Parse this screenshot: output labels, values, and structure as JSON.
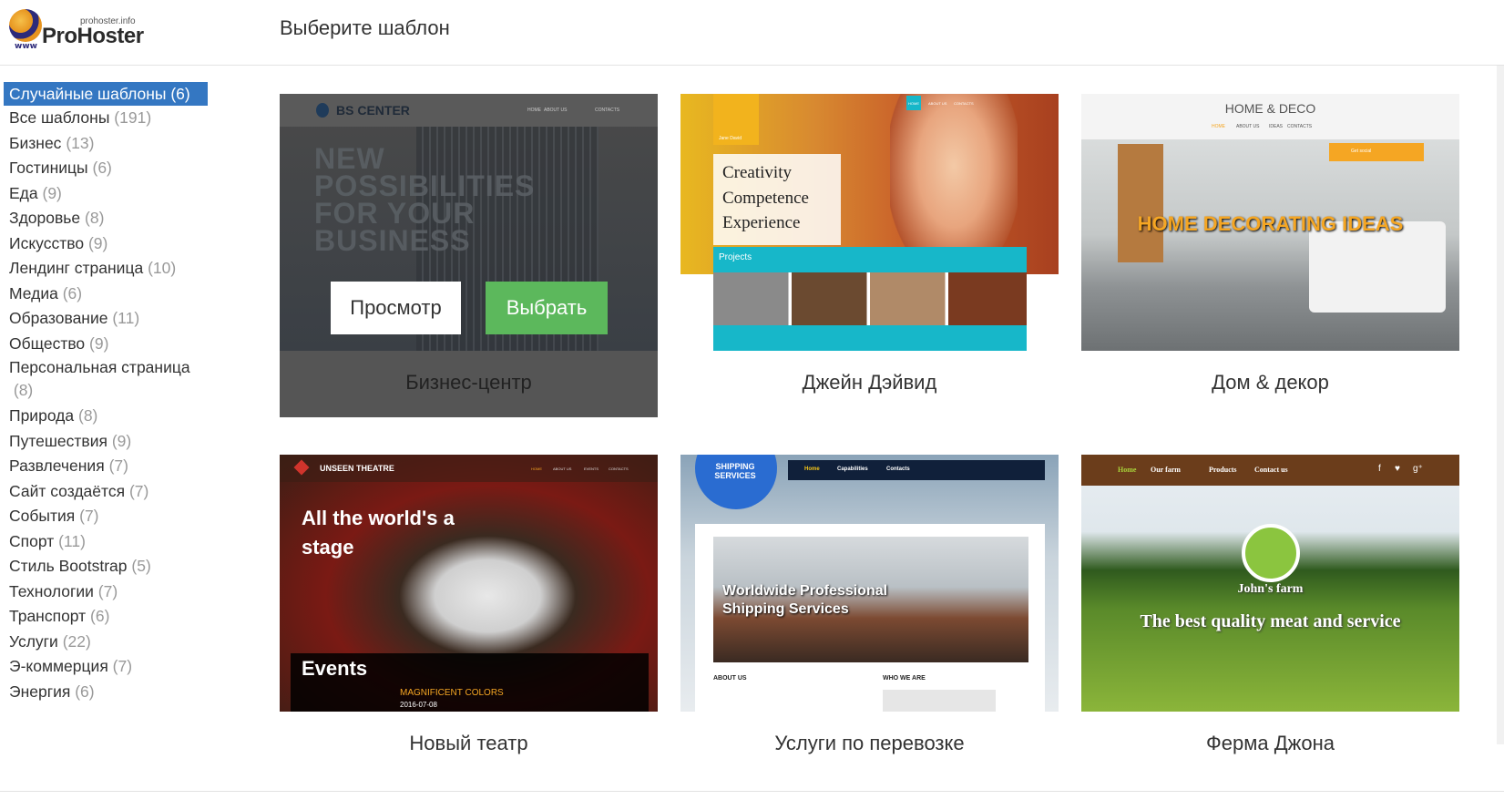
{
  "logo": {
    "small": "prohoster.info",
    "main": "ProHoster",
    "www": "www"
  },
  "page_title": "Выберите шаблон",
  "categories": [
    {
      "name": "Случайные шаблоны",
      "count": "(6)"
    },
    {
      "name": "Все шаблоны",
      "count": "(191)"
    },
    {
      "name": "Бизнес",
      "count": "(13)"
    },
    {
      "name": "Гостиницы",
      "count": "(6)"
    },
    {
      "name": "Еда",
      "count": "(9)"
    },
    {
      "name": "Здоровье",
      "count": "(8)"
    },
    {
      "name": "Искусство",
      "count": "(9)"
    },
    {
      "name": "Лендинг страница",
      "count": "(10)"
    },
    {
      "name": "Медиа",
      "count": "(6)"
    },
    {
      "name": "Образование",
      "count": "(11)"
    },
    {
      "name": "Общество",
      "count": "(9)"
    },
    {
      "name": "Персональная страница",
      "count": "(8)"
    },
    {
      "name": "Природа",
      "count": "(8)"
    },
    {
      "name": "Путешествия",
      "count": "(9)"
    },
    {
      "name": "Развлечения",
      "count": "(7)"
    },
    {
      "name": "Сайт создаётся",
      "count": "(7)"
    },
    {
      "name": "События",
      "count": "(7)"
    },
    {
      "name": "Спорт",
      "count": "(11)"
    },
    {
      "name": "Стиль Bootstrap",
      "count": "(5)"
    },
    {
      "name": "Технологии",
      "count": "(7)"
    },
    {
      "name": "Транспорт",
      "count": "(6)"
    },
    {
      "name": "Услуги",
      "count": "(22)"
    },
    {
      "name": "Э-коммерция",
      "count": "(7)"
    },
    {
      "name": "Энергия",
      "count": "(6)"
    }
  ],
  "templates": [
    {
      "title": "Бизнес-центр",
      "thumb": {
        "brand": "BS CENTER",
        "nav": [
          "HOME",
          "ABOUT US",
          "CONTACTS"
        ],
        "headline": "NEW POSSIBILITIES FOR YOUR BUSINESS"
      }
    },
    {
      "title": "Джейн Дэйвид",
      "thumb": {
        "logo_text": "Jane David",
        "nav": [
          "HOME",
          "ABOUT US",
          "CONTACTS"
        ],
        "lines": [
          "Creativity",
          "Competence",
          "Experience"
        ],
        "section": "Projects"
      }
    },
    {
      "title": "Дом & декор",
      "thumb": {
        "brand": "HOME & DECO",
        "nav": [
          "HOME",
          "ABOUT US",
          "IDEAS",
          "CONTACTS"
        ],
        "social": "Get social",
        "headline": "HOME DECORATING IDEAS"
      }
    },
    {
      "title": "Новый театр",
      "thumb": {
        "brand": "UNSEEN THEATRE",
        "nav": [
          "HOME",
          "ABOUT US",
          "EVENTS",
          "CONTACTS"
        ],
        "headline": "All the world's a stage",
        "events": "Events",
        "event_name": "MAGNIFICENT COLORS",
        "event_date": "2016-07-08"
      }
    },
    {
      "title": "Услуги по перевозке",
      "thumb": {
        "badge": "SHIPPING SERVICES",
        "nav": [
          "Home",
          "Capabilities",
          "Contacts"
        ],
        "headline": "Worldwide Professional Shipping Services",
        "about": "ABOUT US",
        "who": "WHO WE ARE"
      }
    },
    {
      "title": "Ферма Джона",
      "thumb": {
        "nav": [
          "Home",
          "Our farm",
          "Products",
          "Contact us"
        ],
        "name": "John's farm",
        "headline": "The best quality meat and service"
      }
    }
  ],
  "buttons": {
    "preview": "Просмотр",
    "select": "Выбрать"
  },
  "colors": {
    "active": "#3477c2",
    "select_button": "#5cb85c",
    "hover_overlay": "#555555"
  }
}
